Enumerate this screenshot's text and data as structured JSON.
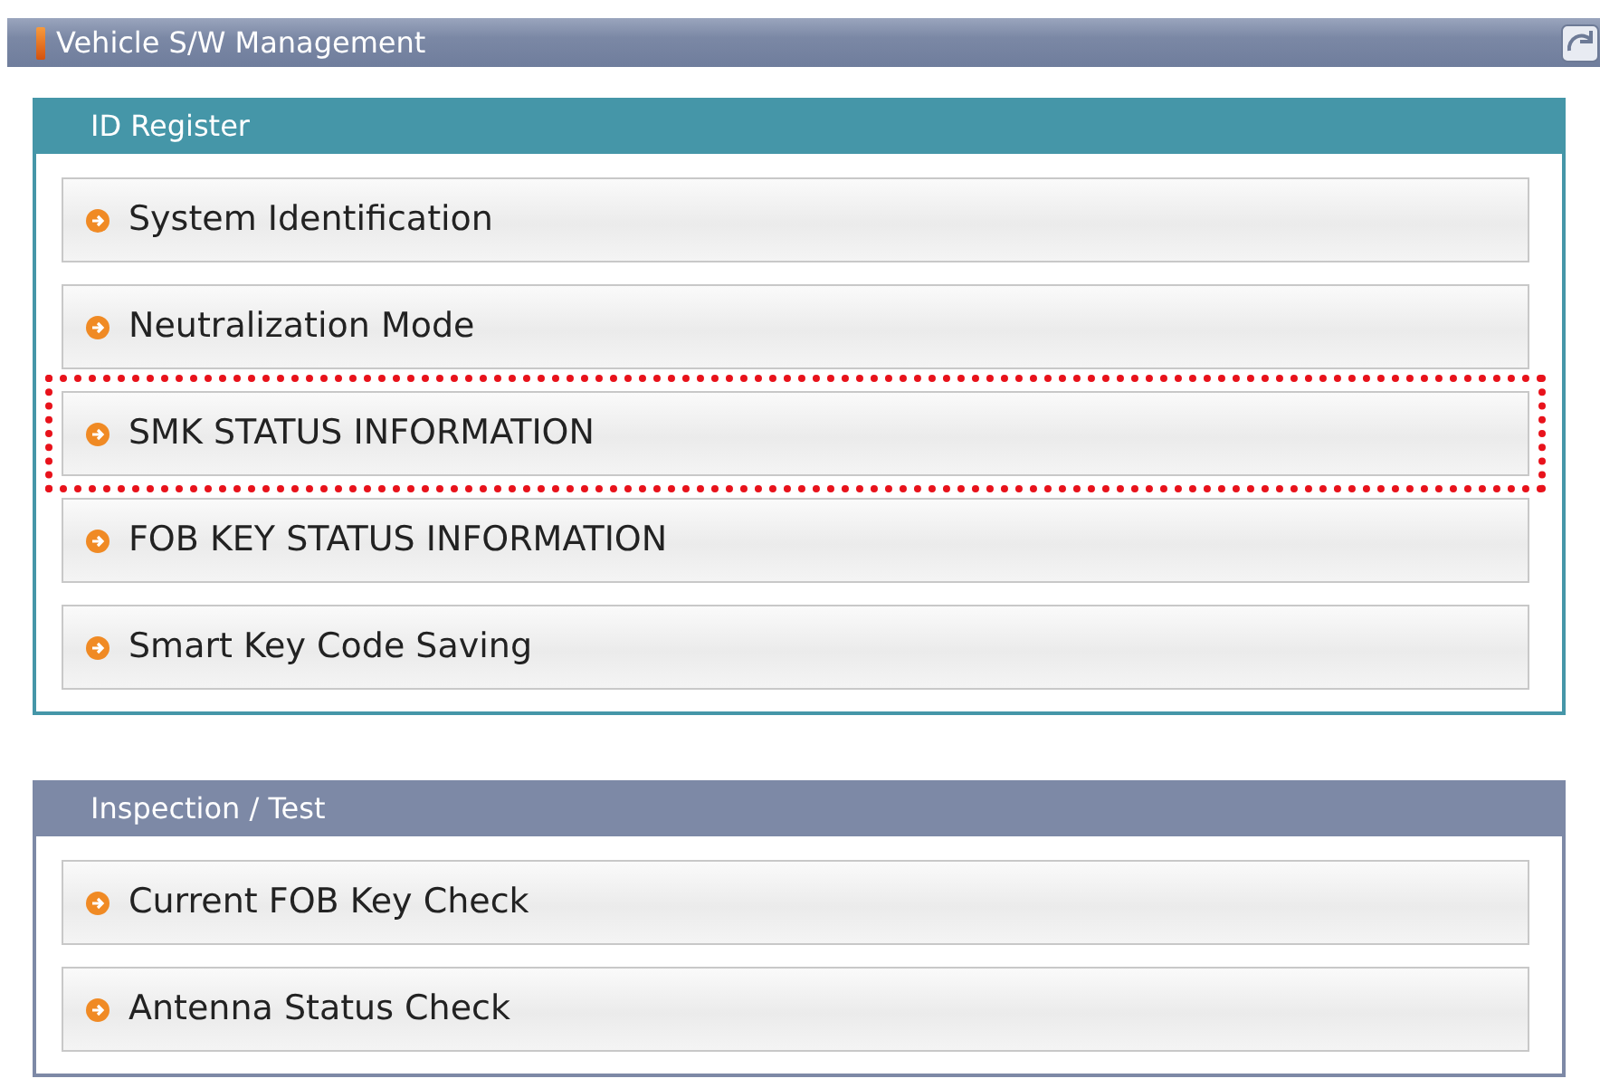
{
  "window": {
    "title": "Vehicle S/W Management"
  },
  "panels": [
    {
      "title": "ID Register",
      "color": "#4596a8",
      "items": [
        {
          "label": "System Identification",
          "highlighted": false
        },
        {
          "label": "Neutralization Mode",
          "highlighted": false
        },
        {
          "label": "SMK STATUS INFORMATION",
          "highlighted": true
        },
        {
          "label": "FOB KEY STATUS INFORMATION",
          "highlighted": false
        },
        {
          "label": "Smart Key Code Saving",
          "highlighted": false
        }
      ]
    },
    {
      "title": "Inspection / Test",
      "color": "#7d89a6",
      "items": [
        {
          "label": "Current FOB Key Check",
          "highlighted": false
        },
        {
          "label": "Antenna Status Check",
          "highlighted": false
        }
      ]
    }
  ]
}
